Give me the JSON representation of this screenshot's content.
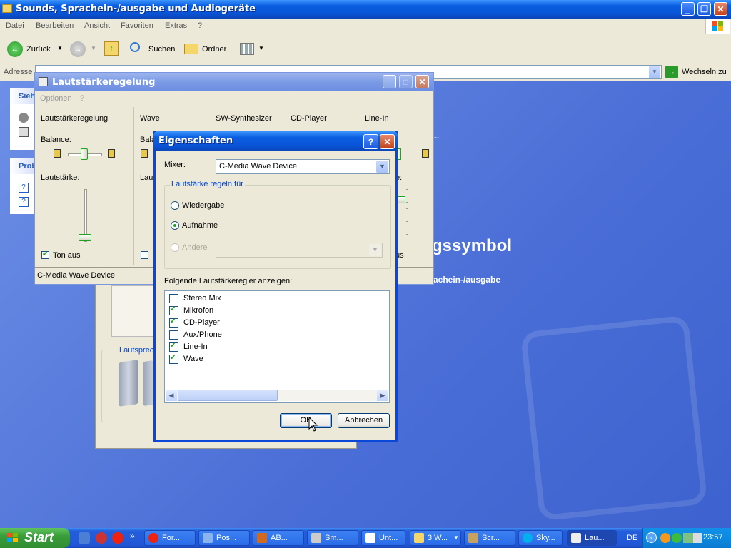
{
  "explorer": {
    "title": "Sounds, Sprachein-/ausgabe und Audiogeräte",
    "menu": [
      "Datei",
      "Bearbeiten",
      "Ansicht",
      "Favoriten",
      "Extras",
      "?"
    ],
    "toolbar": {
      "back": "Zurück",
      "search": "Suchen",
      "folders": "Ordner"
    },
    "address_label": "Adresse",
    "go_label": "Wechseln zu",
    "side_fragments": {
      "see_also": "Sieh",
      "problems": "Prob"
    },
    "bg_heading_fragment": "gssymbol",
    "bg_link_fragment": "achein-/ausgabe",
    "speaker_fragment": "Lautsprech"
  },
  "mixer": {
    "title": "Lautstärkeregelung",
    "menu": [
      "Optionen",
      "?"
    ],
    "columns": [
      "Lautstärkeregelung",
      "Wave",
      "SW-Synthesizer",
      "CD-Player",
      "Line-In"
    ],
    "balance_label": "Balance:",
    "volume_label": "Lautstärke:",
    "mute_label": "Ton aus",
    "device_status": "C-Media Wave Device",
    "partial_labels": {
      "bal": "Bala",
      "lau": "Lau",
      "e": "e:",
      "us": "us"
    }
  },
  "dialog": {
    "title": "Eigenschaften",
    "mixer_label": "Mixer:",
    "mixer_value": "C-Media Wave Device",
    "group_title": "Lautstärke regeln für",
    "radio_playback": "Wiedergabe",
    "radio_record": "Aufnahme",
    "radio_other": "Andere",
    "list_label": "Folgende Lautstärkeregler anzeigen:",
    "items": [
      {
        "label": "Stereo Mix",
        "checked": false
      },
      {
        "label": "Mikrofon",
        "checked": true
      },
      {
        "label": "CD-Player",
        "checked": true
      },
      {
        "label": "Aux/Phone",
        "checked": false
      },
      {
        "label": "Line-In",
        "checked": true
      },
      {
        "label": "Wave",
        "checked": true
      }
    ],
    "ok": "OK",
    "cancel": "Abbrechen"
  },
  "taskbar": {
    "start": "Start",
    "items": [
      "For...",
      "Pos...",
      "AB...",
      "Sm...",
      "Unt...",
      "3 W...",
      "Scr...",
      "Sky...",
      "Lau..."
    ],
    "lang": "DE",
    "clock": "23:57"
  },
  "colors": {
    "xp_blue": "#0a5fe0",
    "start_green": "#3a9c3a",
    "desktop_blue": "#5a7edc"
  }
}
